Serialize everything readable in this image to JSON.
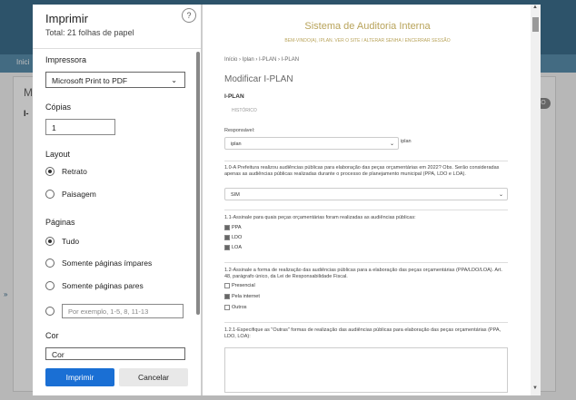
{
  "background": {
    "nav_label": "Inici",
    "heading_initial": "M",
    "sub_initial": "I-",
    "pill_text": "O",
    "chevron": "»"
  },
  "print": {
    "title": "Imprimir",
    "subtitle": "Total: 21 folhas de papel",
    "help_glyph": "?",
    "printer_label": "Impressora",
    "printer_value": "Microsoft Print to PDF",
    "copies_label": "Cópias",
    "copies_value": "1",
    "layout_label": "Layout",
    "layout_options": [
      "Retrato",
      "Paisagem"
    ],
    "pages_label": "Páginas",
    "pages_options": [
      "Tudo",
      "Somente páginas ímpares",
      "Somente páginas pares"
    ],
    "pages_placeholder": "Por exemplo, 1-5, 8, 11-13",
    "color_label": "Cor",
    "color_value": "Cor",
    "print_button": "Imprimir",
    "cancel_button": "Cancelar"
  },
  "preview": {
    "site_title": "Sistema de Auditoria Interna",
    "top_links": "BEM-VINDO(A), IPLAN. VER O SITE / ALTERAR SENHA / ENCERRAR SESSÃO",
    "breadcrumb": "Início › Iplan › I-PLAN › I-PLAN",
    "heading": "Modificar I-PLAN",
    "section": "I-PLAN",
    "history": "HISTÓRICO",
    "responsavel_label": "Responsável:",
    "responsavel_value": "iplan",
    "responsavel_hint": "iplan",
    "q1": "1.0-A Prefeitura realizou audiências públicas para elaboração das peças orçamentárias em 2022? Obs. Serão consideradas apenas as audiências públicas realizadas durante o processo de planejamento municipal (PPA, LDO e LOA).",
    "q1_value": "SIM",
    "q2": "1.1-Assinale para quais peças orçamentárias foram realizadas as audiências públicas:",
    "q2_options": [
      "PPA",
      "LDO",
      "LOA"
    ],
    "q3": "1.2-Assinale a forma de realização das audiências públicas para a elaboração das peças orçamentárias (PPA/LDO/LOA). Art. 48, parágrafo único, da Lei de Responsabilidade Fiscal.",
    "q3_options": [
      "Presencial",
      "Pela internet",
      "Outros"
    ],
    "q3_checked": [
      false,
      true,
      false
    ],
    "q4": "1.2.1-Especifique as \"Outras\" formas de realização das audiências públicas para elaboração das peças orçamentárias (PPA, LDO, LOA):"
  }
}
